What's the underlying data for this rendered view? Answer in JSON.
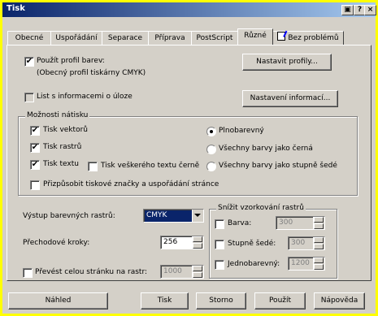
{
  "window": {
    "title": "Tisk"
  },
  "titlebar_buttons": {
    "help": "?",
    "close": "×"
  },
  "tabs": [
    {
      "label": "Obecné"
    },
    {
      "label": "Uspořádání"
    },
    {
      "label": "Separace"
    },
    {
      "label": "Příprava"
    },
    {
      "label": "PostScript"
    },
    {
      "label": "Různé"
    },
    {
      "label": "Bez problémů"
    }
  ],
  "active_tab": "Různé",
  "color_profile": {
    "checkbox_label": "Použít profil barev:",
    "checked": true,
    "profile_name": "(Obecný profil tiskárny CMYK)",
    "button_label": "Nastavit profily..."
  },
  "job_info": {
    "checkbox_label": "List s informacemi o úloze",
    "checked": false,
    "button_label": "Nastavení informací..."
  },
  "print_options": {
    "title": "Možnosti nátisku",
    "print_vectors": {
      "label": "Tisk vektorů",
      "checked": true
    },
    "print_bitmaps": {
      "label": "Tisk rastrů",
      "checked": true
    },
    "print_text": {
      "label": "Tisk textu",
      "checked": true
    },
    "print_all_text_black": {
      "label": "Tisk veškerého textu černě",
      "checked": false
    },
    "fit_marks": {
      "label": "Přizpůsobit tiskové značky a uspořádání stránce",
      "checked": false
    },
    "full_color": {
      "label": "Plnobarevný",
      "selected": true
    },
    "all_colors_black": {
      "label": "Všechny barvy jako černá",
      "selected": false
    },
    "all_colors_gray": {
      "label": "Všechny barvy jako stupně šedé",
      "selected": false
    }
  },
  "output": {
    "bitmap_output_label": "Výstup barevných rastrů:",
    "bitmap_output_value": "CMYK",
    "fountain_steps_label": "Přechodové kroky:",
    "fountain_steps_value": "256",
    "rasterize_label": "Převést celou stránku na rastr:",
    "rasterize_checked": false,
    "rasterize_value": "1000"
  },
  "downsample": {
    "title": "Snížit vzorkování rastrů",
    "color": {
      "label": "Barva:",
      "checked": false,
      "value": "300"
    },
    "grayscale": {
      "label": "Stupně šedé:",
      "checked": false,
      "value": "300"
    },
    "monochrome": {
      "label": "Jednobarevný:",
      "checked": false,
      "value": "1200"
    }
  },
  "bottom_buttons": {
    "preview": "Náhled",
    "print": "Tisk",
    "cancel": "Storno",
    "apply": "Použít",
    "help": "Nápověda"
  }
}
